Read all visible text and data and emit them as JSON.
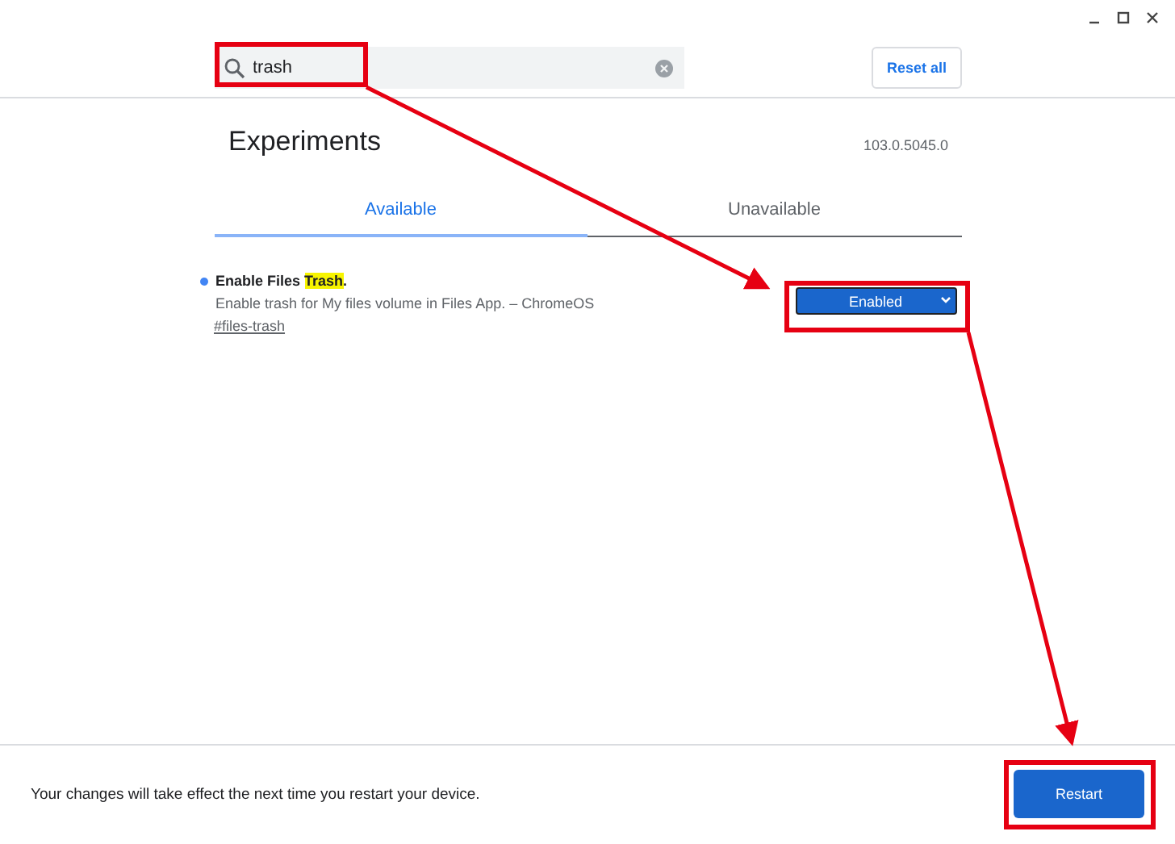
{
  "search": {
    "value": "trash"
  },
  "reset_button": "Reset all",
  "title": "Experiments",
  "version": "103.0.5045.0",
  "tabs": [
    {
      "label": "Available",
      "selected": true
    },
    {
      "label": "Unavailable",
      "selected": false
    }
  ],
  "flags": [
    {
      "title": "Enable Files ",
      "title_match": "Trash",
      "title_end": ".",
      "modified": true,
      "description": "Enable trash for My files volume in Files App. – ChromeOS",
      "link": "#files-trash",
      "value": "Enabled"
    }
  ],
  "footer": {
    "message": "Your changes will take effect the next time you restart your device.",
    "button": "Restart"
  }
}
